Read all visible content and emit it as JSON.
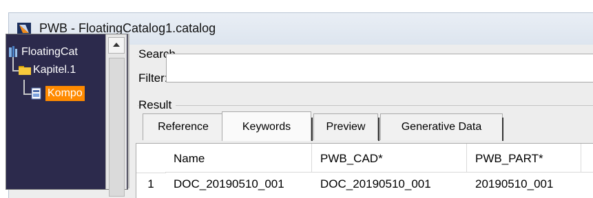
{
  "window": {
    "title": "PWB - FloatingCatalog1.catalog",
    "app_icon": "catalog-app-icon"
  },
  "tree": {
    "items": [
      {
        "label": "FloatingCat",
        "icon": "catalog-tree-icon"
      },
      {
        "label": "Kapitel.1",
        "icon": "folder-icon"
      },
      {
        "label": "Kompo",
        "icon": "component-icon",
        "selected": true
      }
    ],
    "selected_bg": "#ff8a00"
  },
  "search": {
    "group_label": "Search",
    "filter_label": "Filter:",
    "filter_value": ""
  },
  "result": {
    "group_label": "Result",
    "tabs": [
      {
        "label": "Reference"
      },
      {
        "label": "Keywords",
        "active": true
      },
      {
        "label": "Preview"
      },
      {
        "label": "Generative Data"
      }
    ],
    "columns": [
      "Name",
      "PWB_CAD*",
      "PWB_PART*"
    ],
    "rows": [
      {
        "num": "1",
        "cells": [
          "DOC_20190510_001",
          "DOC_20190510_001",
          "20190510_001"
        ]
      }
    ]
  }
}
